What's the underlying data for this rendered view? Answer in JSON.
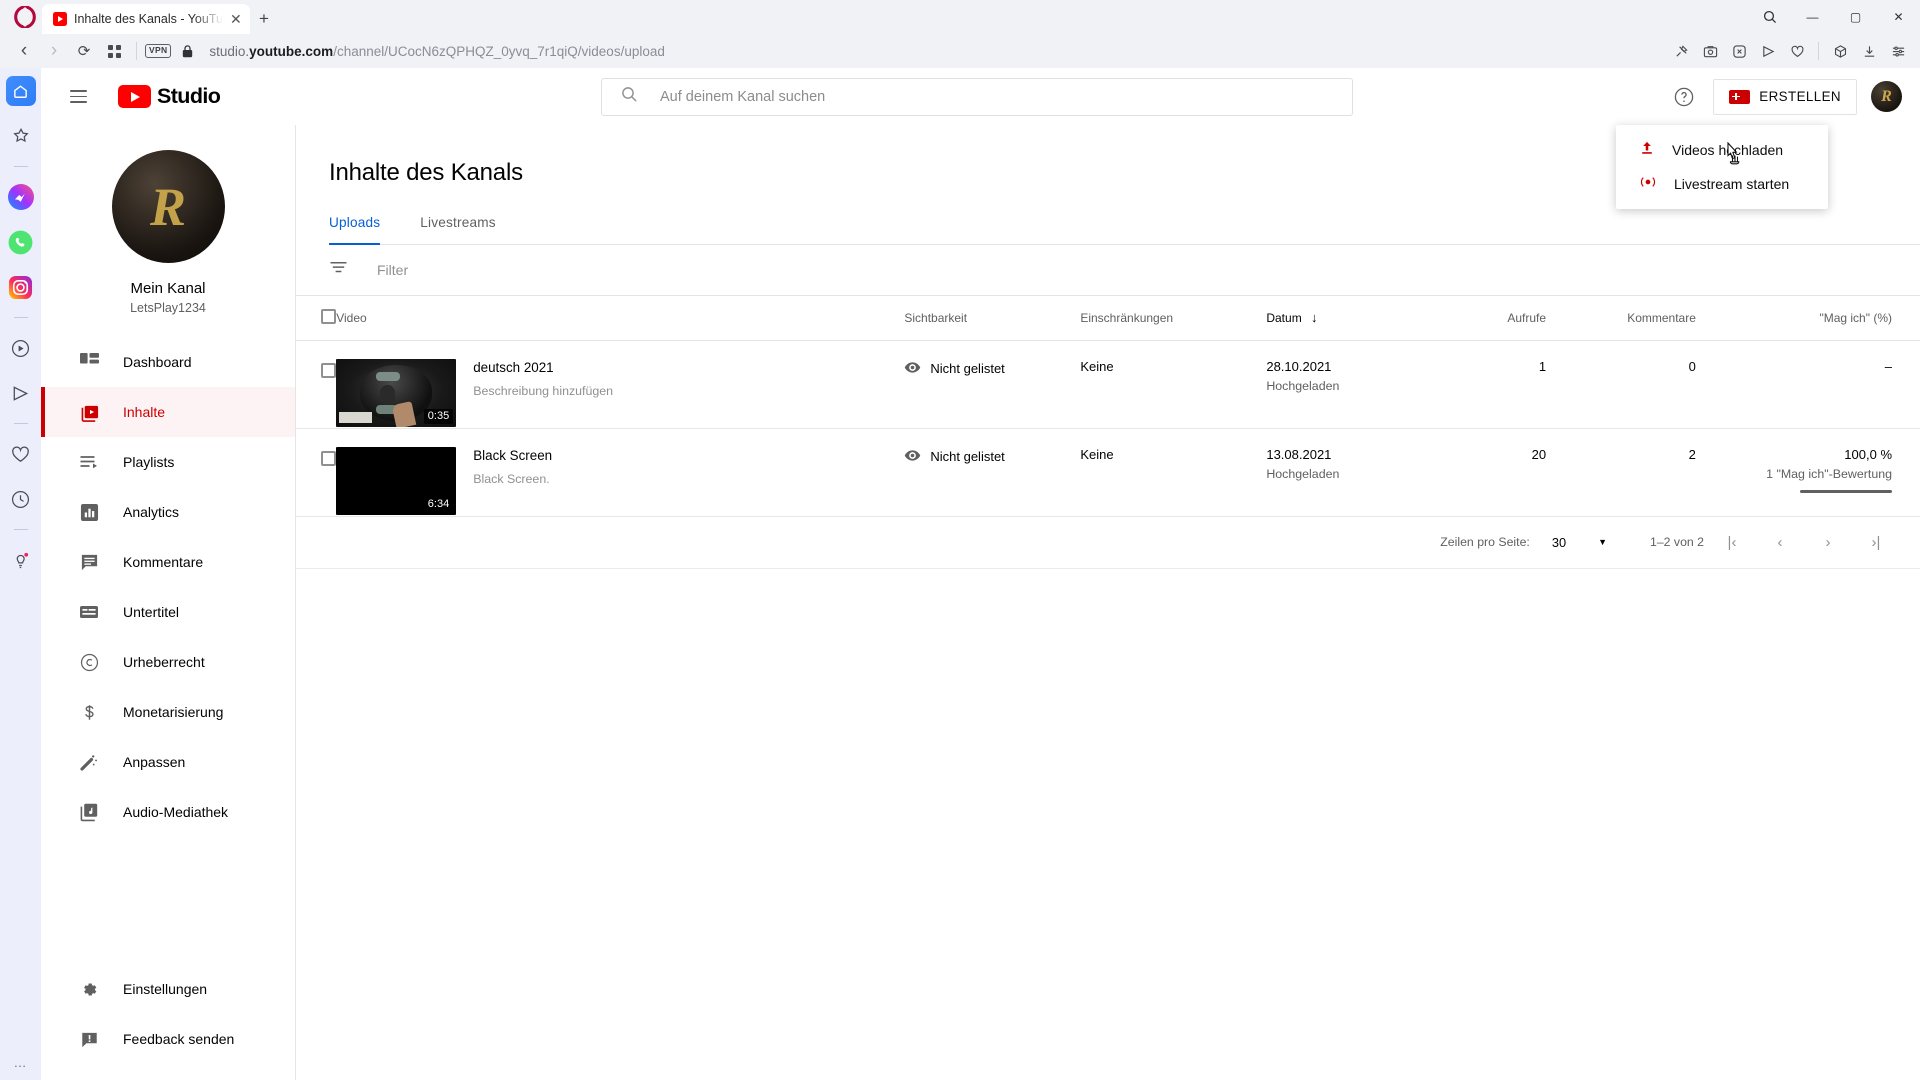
{
  "browser": {
    "tab": {
      "title": "Inhalte des Kanals - YouTu",
      "close": "✕",
      "favicon": "youtube-favicon"
    },
    "newtab_label": "+",
    "window_controls": {
      "minimize": "—",
      "maximize": "▢",
      "close": "✕"
    },
    "nav": {
      "back": "‹",
      "forward": "›",
      "reload": "⟳",
      "tiles": "▯▯",
      "vpn_badge": "VPN",
      "lock": "lock-icon"
    },
    "url": {
      "scheme_hidden": "",
      "host_prefix": "studio.",
      "host_bold": "youtube.com",
      "path": "/channel/UCocN6zQPHQZ_0yvq_7r1qiQ/videos/upload"
    },
    "right_icons": [
      "pin-icon",
      "snapshot-icon",
      "adblock-icon",
      "send-icon",
      "heart-icon",
      "package-icon",
      "download-icon",
      "settings-lines-icon"
    ],
    "search_icon": "search-icon"
  },
  "opera_sidebar": {
    "items": [
      {
        "name": "home-icon",
        "type": "home"
      },
      {
        "name": "favorites-star-icon",
        "type": "star"
      },
      {
        "name": "divider",
        "type": "divider"
      },
      {
        "name": "messenger-icon",
        "type": "messenger"
      },
      {
        "name": "whatsapp-icon",
        "type": "whatsapp"
      },
      {
        "name": "instagram-icon",
        "type": "instagram"
      },
      {
        "name": "divider",
        "type": "divider"
      },
      {
        "name": "player-icon",
        "type": "player"
      },
      {
        "name": "send-icon",
        "type": "send"
      },
      {
        "name": "divider",
        "type": "divider"
      },
      {
        "name": "heart-icon",
        "type": "heart"
      },
      {
        "name": "history-clock-icon",
        "type": "clock"
      },
      {
        "name": "divider",
        "type": "divider"
      },
      {
        "name": "tips-bulb-icon",
        "type": "bulb"
      }
    ],
    "more_dots": "…"
  },
  "studio": {
    "brand": "Studio",
    "search": {
      "placeholder": "Auf deinem Kanal suchen"
    },
    "help_label": "?",
    "create_button": "ERSTELLEN",
    "avatar_initial": "R",
    "create_menu": [
      {
        "label": "Videos hochladen",
        "icon": "upload-icon"
      },
      {
        "label": "Livestream starten",
        "icon": "livestream-icon"
      }
    ],
    "channel": {
      "avatar_initial": "R",
      "name": "Mein Kanal",
      "handle": "LetsPlay1234"
    },
    "nav_items": [
      {
        "label": "Dashboard",
        "icon": "dashboard-icon",
        "active": false
      },
      {
        "label": "Inhalte",
        "icon": "content-video-icon",
        "active": true
      },
      {
        "label": "Playlists",
        "icon": "playlist-icon",
        "active": false
      },
      {
        "label": "Analytics",
        "icon": "analytics-bars-icon",
        "active": false
      },
      {
        "label": "Kommentare",
        "icon": "comment-icon",
        "active": false
      },
      {
        "label": "Untertitel",
        "icon": "subtitles-icon",
        "active": false
      },
      {
        "label": "Urheberrecht",
        "icon": "copyright-icon",
        "active": false
      },
      {
        "label": "Monetarisierung",
        "icon": "dollar-icon",
        "active": false
      },
      {
        "label": "Anpassen",
        "icon": "magic-wand-icon",
        "active": false
      },
      {
        "label": "Audio-Mediathek",
        "icon": "audio-library-icon",
        "active": false
      }
    ],
    "nav_bottom": [
      {
        "label": "Einstellungen",
        "icon": "gear-icon"
      },
      {
        "label": "Feedback senden",
        "icon": "feedback-icon"
      }
    ],
    "page_title": "Inhalte des Kanals",
    "tabs": [
      {
        "label": "Uploads",
        "selected": true
      },
      {
        "label": "Livestreams",
        "selected": false
      }
    ],
    "filter": {
      "icon": "filter-icon",
      "placeholder": "Filter"
    },
    "table": {
      "columns": [
        "Video",
        "Sichtbarkeit",
        "Einschränkungen",
        "Datum",
        "Aufrufe",
        "Kommentare",
        "\"Mag ich\" (%)"
      ],
      "sort_column": "Datum",
      "sort_arrow": "↓",
      "rows": [
        {
          "title": "deutsch 2021",
          "description": "Beschreibung hinzufügen",
          "duration": "0:35",
          "thumb_type": "scale-photo",
          "visibility": "Nicht gelistet",
          "visibility_icon": "eye-icon",
          "restrictions": "Keine",
          "date": "28.10.2021",
          "date_sub": "Hochgeladen",
          "views": "1",
          "comments": "0",
          "likes_pct": "–",
          "likes_sub": "",
          "like_bar_pct": 0
        },
        {
          "title": "Black Screen",
          "description": "Black Screen.",
          "duration": "6:34",
          "thumb_type": "black",
          "visibility": "Nicht gelistet",
          "visibility_icon": "eye-icon",
          "restrictions": "Keine",
          "date": "13.08.2021",
          "date_sub": "Hochgeladen",
          "views": "20",
          "comments": "2",
          "likes_pct": "100,0 %",
          "likes_sub": "1 \"Mag ich\"-Bewertung",
          "like_bar_pct": 100
        }
      ]
    },
    "pager": {
      "rows_label": "Zeilen pro Seite:",
      "rows_value": "30",
      "caret": "▼",
      "range": "1–2 von 2",
      "first": "|‹",
      "prev": "‹",
      "next": "›",
      "last": "›|"
    }
  },
  "colors": {
    "yt_red": "#cc0000",
    "accent_blue": "#065fd4",
    "opera_red": "#b3093c",
    "sidebar_bg": "#eceefb"
  }
}
